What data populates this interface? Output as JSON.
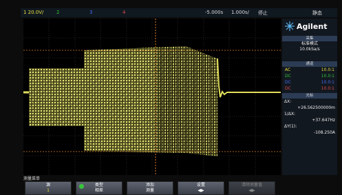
{
  "status_bar": {
    "ch1_scale": "1  20.0V/",
    "ch2": "2",
    "ch3": "3",
    "ch4": "4",
    "time_offset": "-5.000s",
    "time_scale": "1.000s/",
    "run_state": "停止",
    "trigger": "静态"
  },
  "brand": {
    "name": "Agilent"
  },
  "acquisition": {
    "title": "采集",
    "mode": "标准模式",
    "rate": "10.0kSa/s"
  },
  "channels": {
    "title": "通道",
    "rows": [
      {
        "coupling": "AC",
        "probe": "10.0:1",
        "color": "#e8e040"
      },
      {
        "coupling": "DC",
        "probe": "10.0:1",
        "color": "#39c43b"
      },
      {
        "coupling": "DC",
        "probe": "10.0:1",
        "color": "#4a6cf0"
      },
      {
        "coupling": "DC",
        "probe": "10.0:1",
        "color": "#e04a4a"
      }
    ]
  },
  "cursors": {
    "title": "光标",
    "delta_x_label": "ΔX:",
    "delta_x_value": "+26.562500000m",
    "inv_delta_x_label": "1/ΔX:",
    "inv_delta_x_value": "+37.647Hz",
    "delta_y_label": "ΔY(1):",
    "delta_y_value": "-108.250A"
  },
  "softkey_menu": {
    "title": "测量菜单",
    "keys": [
      {
        "label": "源",
        "value": "1"
      },
      {
        "label": "类型",
        "value": "相差"
      },
      {
        "label": "添加",
        "value": "测量"
      },
      {
        "label": "设置",
        "value": "◀▶"
      },
      {
        "label": "清除测量值",
        "value": "◀▶"
      }
    ]
  },
  "colors": {
    "trace": "#e3df5c",
    "cursor_v": "#e0832a",
    "cursor_h": "#e0832a",
    "grid": "#4a3c40"
  }
}
